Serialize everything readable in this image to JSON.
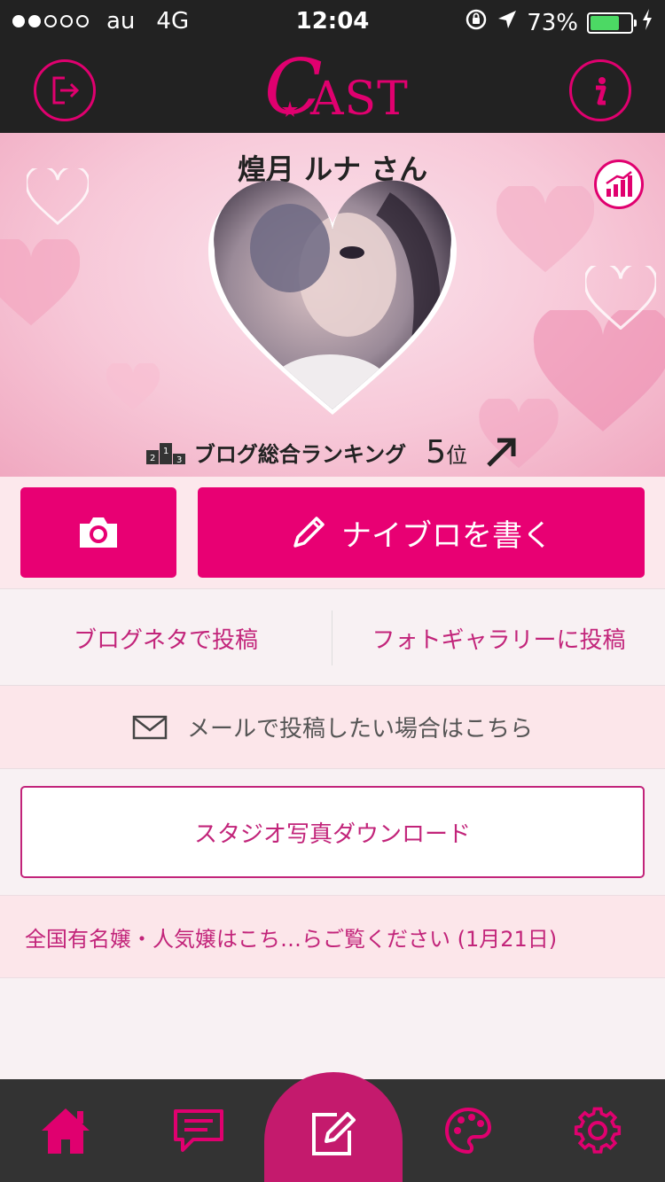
{
  "status_bar": {
    "carrier": "au",
    "network": "4G",
    "time": "12:04",
    "battery_percent": "73%",
    "battery_level": 0.73
  },
  "header": {
    "logo_text": "CAST",
    "logo_first_letter": "C",
    "logo_rest": "AST",
    "left_icon": "logout-icon",
    "right_icon": "info-icon"
  },
  "profile": {
    "name": "煌月 ルナ さん",
    "ranking_label": "ブログ総合ランキング",
    "ranking_position": "5",
    "ranking_suffix": "位",
    "podium_digits": [
      "2",
      "1",
      "3"
    ],
    "stats_icon": "bar-chart-icon",
    "trend_icon": "arrow-up-right-icon"
  },
  "actions": {
    "camera_icon": "camera-icon",
    "write_label": "ナイブロを書く",
    "write_icon": "pencil-icon"
  },
  "links": {
    "blog_topic": "ブログネタで投稿",
    "photo_gallery": "フォトギャラリーに投稿"
  },
  "mail": {
    "label": "メールで投稿したい場合はこちら",
    "icon": "envelope-icon"
  },
  "studio": {
    "label": "スタジオ写真ダウンロード"
  },
  "news": {
    "text": "全国有名嬢・人気嬢はこち…らご覧ください (1月21日)"
  },
  "tabbar": {
    "items": [
      "home-icon",
      "chat-icon",
      "compose-icon",
      "palette-icon",
      "settings-icon"
    ]
  },
  "colors": {
    "accent": "#e80073",
    "accent_text": "#c2247a",
    "dark_bar": "#222222",
    "tab_bar": "#333333"
  }
}
